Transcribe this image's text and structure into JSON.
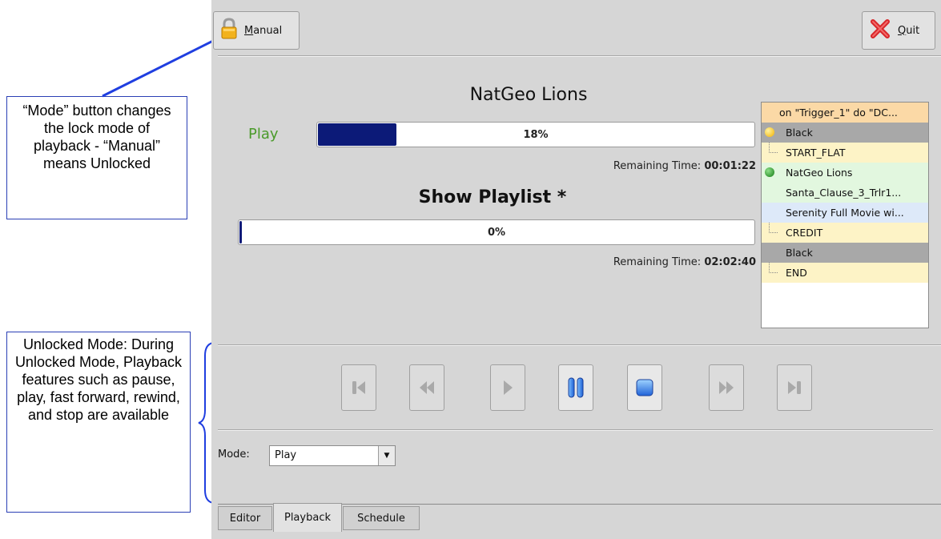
{
  "callouts": {
    "mode_note": "“Mode” button changes the lock mode of playback - “Manual” means Unlocked",
    "unlocked_note": "Unlocked Mode: During Unlocked Mode, Playback features such as pause, play, fast forward, rewind, and stop are available"
  },
  "toolbar": {
    "manual_icon": "lock-icon",
    "manual_access": "M",
    "manual_rest": "anual",
    "quit_icon": "red-x-icon",
    "quit_access": "Q",
    "quit_rest": "uit"
  },
  "now_playing": {
    "status": "Play",
    "title": "NatGeo Lions",
    "progress_text": "18%",
    "progress": 0.18,
    "remaining_label": "Remaining Time:",
    "remaining_value": "00:01:22"
  },
  "playlist_status": {
    "title": "Show Playlist *",
    "progress_text": "0%",
    "progress": 0.0,
    "remaining_label": "Remaining Time:",
    "remaining_value": "02:02:40"
  },
  "playlist": {
    "items": [
      {
        "label": "on \"Trigger_1\" do \"DC...",
        "bg": "#fbd9a6",
        "marker": "none"
      },
      {
        "label": "Black",
        "bg": "#a8a8a8",
        "marker": "yellow-dot"
      },
      {
        "label": "START_FLAT",
        "bg": "#fdf3c6",
        "marker": "branch"
      },
      {
        "label": "NatGeo Lions",
        "bg": "#e2f7df",
        "marker": "green-dot"
      },
      {
        "label": "Santa_Clause_3_Trlr1...",
        "bg": "#e2f7df",
        "marker": "none"
      },
      {
        "label": "Serenity Full Movie wi...",
        "bg": "#dde9f9",
        "marker": "none"
      },
      {
        "label": "CREDIT",
        "bg": "#fdf3c6",
        "marker": "branch"
      },
      {
        "label": "Black",
        "bg": "#a8a8a8",
        "marker": "none"
      },
      {
        "label": "END",
        "bg": "#fdf3c6",
        "marker": "branch"
      }
    ]
  },
  "transport": {
    "buttons": [
      "skip-to-start-icon",
      "rewind-icon",
      "play-icon",
      "pause-icon",
      "stop-icon",
      "fast-forward-icon",
      "skip-to-end-icon"
    ]
  },
  "mode": {
    "label": "Mode:",
    "value": "Play"
  },
  "tabs": [
    "Editor",
    "Playback",
    "Schedule"
  ],
  "colors": {
    "progress_fill": "#0c1a78",
    "play_green": "#4a9a2a",
    "callout_border": "#2a3fb5"
  }
}
